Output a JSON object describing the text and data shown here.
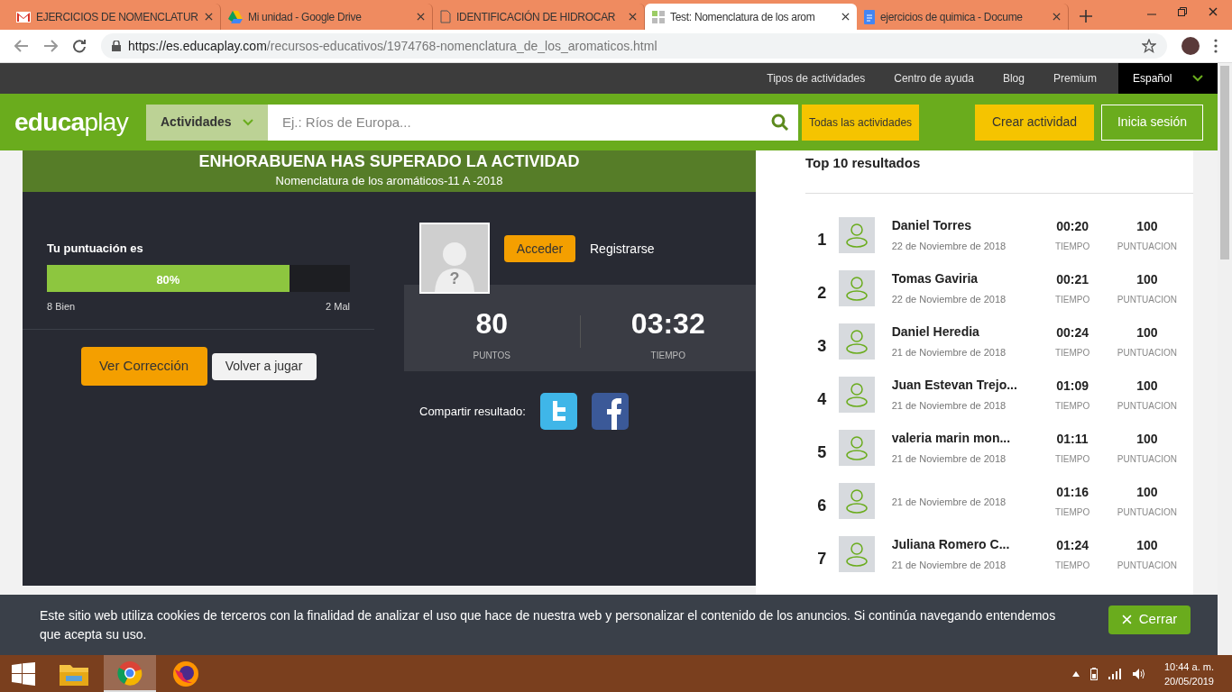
{
  "browser": {
    "tabs": [
      {
        "title": "EJERCICIOS DE NOMENCLATUR",
        "kind": "gmail",
        "selected": false
      },
      {
        "title": "Mi unidad - Google Drive",
        "kind": "drive",
        "selected": false
      },
      {
        "title": "IDENTIFICACIÓN DE HIDROCAR",
        "kind": "page",
        "selected": false
      },
      {
        "title": "Test: Nomenclatura de los arom",
        "kind": "grid",
        "selected": true
      },
      {
        "title": "ejercicios de quimica - Docume",
        "kind": "docs",
        "selected": false
      }
    ],
    "url_host": "https://es.educaplay.com",
    "url_path": "/recursos-educativos/1974768-nomenclatura_de_los_aromaticos.html"
  },
  "site": {
    "top_links": [
      "Tipos de actividades",
      "Centro de ayuda",
      "Blog",
      "Premium"
    ],
    "language": "Español",
    "logo": [
      "educa",
      "play"
    ],
    "category": "Actividades",
    "search_placeholder": "Ej.: Ríos de Europa...",
    "all_activities": "Todas las actividades",
    "create": "Crear actividad",
    "login": "Inicia sesión"
  },
  "result": {
    "title": "ENHORABUENA HAS SUPERADO LA ACTIVIDAD",
    "subtitle": "Nomenclatura de los aromáticos-11 A -2018",
    "score_label": "Tu puntuación es",
    "score": {
      "level": 0.8,
      "text": "80%"
    },
    "good": "8 Bien",
    "bad": "2 Mal",
    "review": "Ver Corrección",
    "replay": "Volver a jugar",
    "access": "Acceder",
    "register": "Registrarse",
    "avatar_symbol": "?",
    "points": "80",
    "points_label": "PUNTOS",
    "time": "03:32",
    "time_label": "TIEMPO",
    "share_label": "Compartir resultado:"
  },
  "ranking": {
    "title": "Top 10 resultados",
    "rows": [
      {
        "rank": "1",
        "name": "Daniel Torres",
        "date": "22 de Noviembre de 2018",
        "time": "00:20",
        "time_label": "TIEMPO",
        "score": "100",
        "score_label": "PUNTUACION"
      },
      {
        "rank": "2",
        "name": "Tomas Gaviria",
        "date": "22 de Noviembre de 2018",
        "time": "00:21",
        "time_label": "TIEMPO",
        "score": "100",
        "score_label": "PUNTUACION"
      },
      {
        "rank": "3",
        "name": "Daniel Heredia",
        "date": "21 de Noviembre de 2018",
        "time": "00:24",
        "time_label": "TIEMPO",
        "score": "100",
        "score_label": "PUNTUACION"
      },
      {
        "rank": "4",
        "name": "Juan Estevan Trejo...",
        "date": "21 de Noviembre de 2018",
        "time": "01:09",
        "time_label": "TIEMPO",
        "score": "100",
        "score_label": "PUNTUACION"
      },
      {
        "rank": "5",
        "name": "valeria marin mon...",
        "date": "21 de Noviembre de 2018",
        "time": "01:11",
        "time_label": "TIEMPO",
        "score": "100",
        "score_label": "PUNTUACION"
      },
      {
        "rank": "6",
        "date": "21 de Noviembre de 2018",
        "time": "01:16",
        "time_label": "TIEMPO",
        "score": "100",
        "score_label": "PUNTUACION"
      },
      {
        "rank": "7",
        "name": "Juliana Romero C...",
        "date": "21 de Noviembre de 2018",
        "time": "01:24",
        "time_label": "TIEMPO",
        "score": "100",
        "score_label": "PUNTUACION"
      }
    ]
  },
  "cookie": {
    "text": "Este sitio web utiliza cookies de terceros con la finalidad de analizar el uso que hace de nuestra web y personalizar el contenido de los anuncios. Si continúa navegando entendemos que acepta su uso.",
    "close": "Cerrar"
  },
  "taskbar": {
    "time": "10:44 a. m.",
    "date": "20/05/2019"
  }
}
